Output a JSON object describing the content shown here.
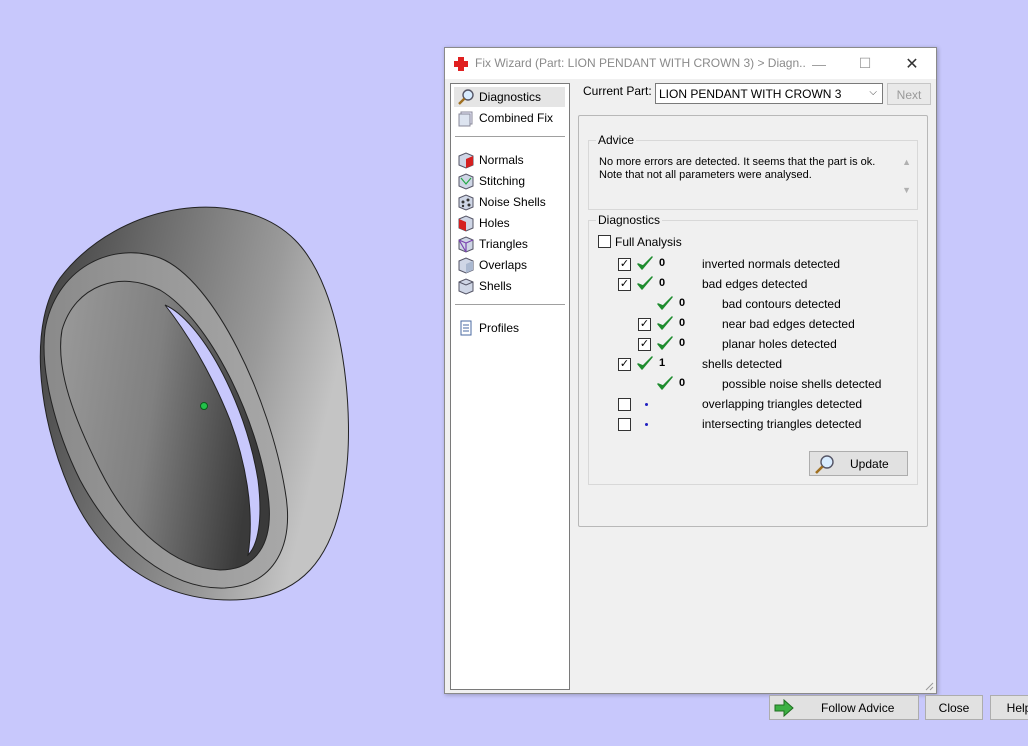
{
  "window": {
    "title": "Fix Wizard (Part: LION PENDANT WITH CROWN 3) > Diagn...",
    "minimize_glyph": "—",
    "maximize_glyph": "☐",
    "close_glyph": "✕"
  },
  "sidebar": {
    "items": [
      {
        "label": "Diagnostics",
        "icon": "magnifier-icon"
      },
      {
        "label": "Combined Fix",
        "icon": "combined-fix-icon"
      },
      {
        "label": "Normals",
        "icon": "normals-cube-icon"
      },
      {
        "label": "Stitching",
        "icon": "stitching-cube-icon"
      },
      {
        "label": "Noise Shells",
        "icon": "noise-shells-cube-icon"
      },
      {
        "label": "Holes",
        "icon": "holes-cube-icon"
      },
      {
        "label": "Triangles",
        "icon": "triangles-cube-icon"
      },
      {
        "label": "Overlaps",
        "icon": "overlaps-cube-icon"
      },
      {
        "label": "Shells",
        "icon": "shells-cube-icon"
      },
      {
        "label": "Profiles",
        "icon": "profiles-document-icon"
      }
    ]
  },
  "main": {
    "current_part_label": "Current Part:",
    "current_part_value": "LION PENDANT WITH CROWN 3",
    "next_label": "Next",
    "advice": {
      "title": "Advice",
      "line1": "No more errors are detected. It seems that the part is ok.",
      "line2": "Note that not all parameters were analysed."
    },
    "diagnostics": {
      "title": "Diagnostics",
      "full_analysis_label": "Full Analysis",
      "rows": [
        {
          "checked": true,
          "status": "ok",
          "count": "0",
          "label": "inverted normals detected"
        },
        {
          "checked": true,
          "status": "ok",
          "count": "0",
          "label": "bad edges detected"
        },
        {
          "checked": null,
          "status": "ok",
          "count": "0",
          "label": "bad contours detected"
        },
        {
          "checked": true,
          "status": "ok",
          "count": "0",
          "label": "near bad edges detected"
        },
        {
          "checked": true,
          "status": "ok",
          "count": "0",
          "label": "planar holes detected"
        },
        {
          "checked": true,
          "status": "ok",
          "count": "1",
          "label": "shells detected"
        },
        {
          "checked": null,
          "status": "ok",
          "count": "0",
          "label": "possible noise shells detected"
        },
        {
          "checked": false,
          "status": "not-analysed",
          "count": "",
          "label": "overlapping triangles detected"
        },
        {
          "checked": false,
          "status": "not-analysed",
          "count": "",
          "label": "intersecting triangles detected"
        }
      ],
      "update_label": "Update"
    },
    "buttons": {
      "follow_advice": "Follow Advice",
      "close": "Close",
      "help": "Help"
    }
  },
  "colors": {
    "background": "#c8c8fc",
    "check_green": "#1e8c2e",
    "arrow_green": "#3cb043",
    "title_icon_red": "#e02020"
  }
}
